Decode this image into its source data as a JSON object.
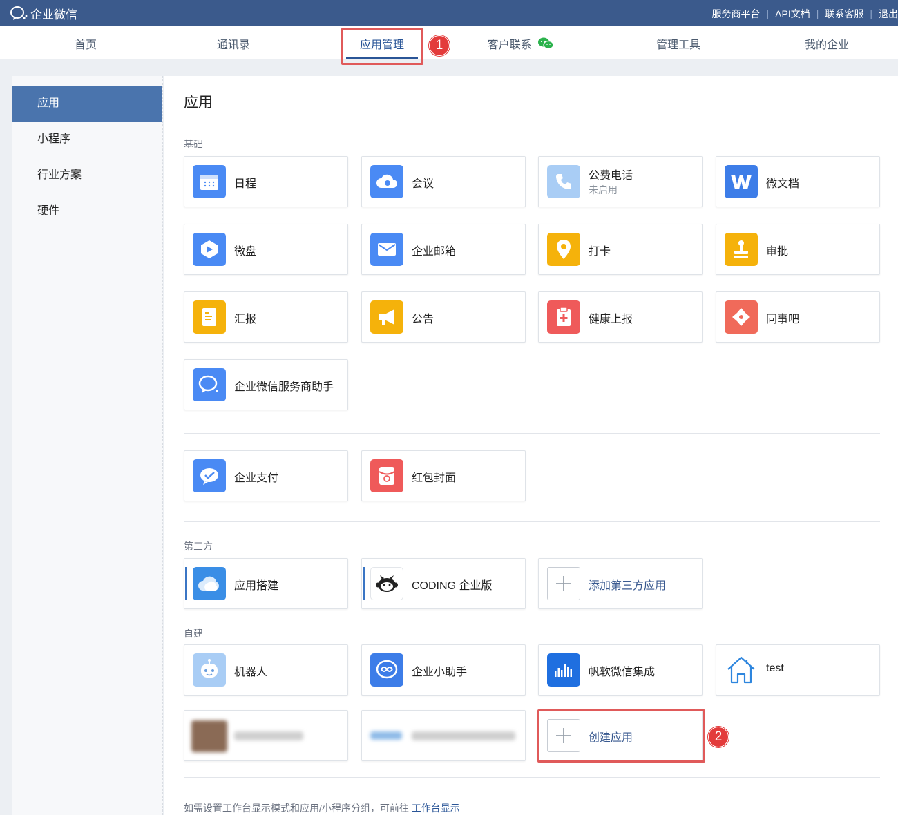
{
  "topbar": {
    "app_name": "企业微信",
    "links": [
      "服务商平台",
      "API文档",
      "联系客服",
      "退出"
    ],
    "color": "#3b5a8c"
  },
  "nav": {
    "items": [
      "首页",
      "通讯录",
      "应用管理",
      "客户联系",
      "管理工具",
      "我的企业"
    ],
    "active": "应用管理"
  },
  "callouts": [
    "1",
    "2"
  ],
  "sidebar": {
    "items": [
      "应用",
      "小程序",
      "行业方案",
      "硬件"
    ],
    "active": "应用"
  },
  "main": {
    "title": "应用",
    "basic_section": "基础",
    "basic_apps": [
      {
        "name": "日程",
        "icon": "calendar-icon",
        "color": "#4a8af4"
      },
      {
        "name": "会议",
        "icon": "meeting-cloud-icon",
        "color": "#4a8af4"
      },
      {
        "name": "公费电话",
        "status": "未启用",
        "icon": "phone-icon",
        "color": "#a9cdf5"
      },
      {
        "name": "微文档",
        "icon": "doc-w-icon",
        "color": "#3d7de8"
      },
      {
        "name": "微盘",
        "icon": "drive-icon",
        "color": "#4a8af4"
      },
      {
        "name": "企业邮箱",
        "icon": "mail-icon",
        "color": "#4a8af4"
      },
      {
        "name": "打卡",
        "icon": "location-pin-icon",
        "color": "#f5b20b"
      },
      {
        "name": "审批",
        "icon": "stamp-icon",
        "color": "#f5b20b"
      },
      {
        "name": "汇报",
        "icon": "report-icon",
        "color": "#f5b20b"
      },
      {
        "name": "公告",
        "icon": "megaphone-icon",
        "color": "#f5b20b"
      },
      {
        "name": "健康上报",
        "icon": "health-clipboard-icon",
        "color": "#ef5a5a"
      },
      {
        "name": "同事吧",
        "icon": "colleague-icon",
        "color": "#f06a5a"
      },
      {
        "name": "企业微信服务商助手",
        "icon": "chat-bubble-icon",
        "color": "#4a8af4"
      }
    ],
    "payment_apps": [
      {
        "name": "企业支付",
        "icon": "payment-icon",
        "color": "#4a8af4"
      },
      {
        "name": "红包封面",
        "icon": "red-envelope-icon",
        "color": "#ef5a5a"
      }
    ],
    "third_party_section": "第三方",
    "third_party_apps": [
      {
        "name": "应用搭建",
        "icon": "cloud-icon",
        "color": "#3a8ee6"
      },
      {
        "name": "CODING 企业版",
        "icon": "coding-monkey-icon",
        "color": "#ffffff"
      },
      {
        "name": "添加第三方应用",
        "icon": "plus-icon",
        "color": "#ffffff"
      }
    ],
    "custom_section": "自建",
    "custom_apps": [
      {
        "name": "机器人",
        "icon": "robot-icon",
        "color": "#a9cdf5"
      },
      {
        "name": "企业小助手",
        "icon": "assistant-icon",
        "color": "#3d7de8"
      },
      {
        "name": "帆软微信集成",
        "icon": "chart-bars-icon",
        "color": "#1f6fe0"
      },
      {
        "name": "test",
        "icon": "house-icon",
        "color": "#ffffff"
      },
      {
        "name": "创建应用",
        "icon": "plus-icon",
        "color": "#ffffff"
      }
    ],
    "footer_text": "如需设置工作台显示模式和应用/小程序分组，可前往",
    "footer_link": "工作台显示"
  }
}
